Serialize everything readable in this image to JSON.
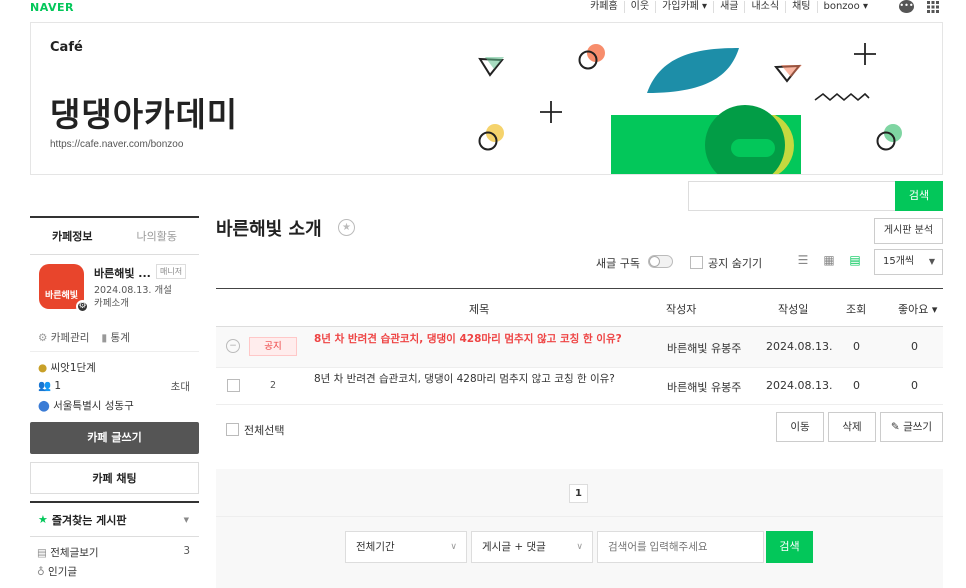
{
  "gnb": {
    "logo": "NAVER",
    "links": [
      "카페홈",
      "이웃",
      "가입카페 ▾",
      "새글",
      "내소식",
      "채팅",
      "bonzoo ▾"
    ]
  },
  "banner": {
    "logo": "Café",
    "cafe_name": "댕댕아카데미",
    "url": "https://cafe.naver.com/bonzoo"
  },
  "top_search": {
    "button": "검색"
  },
  "sidebar": {
    "tabs": [
      "카페정보",
      "나의활동"
    ],
    "profile": {
      "image_text": "바른해빛",
      "name": "바른해빛 ...",
      "badge": "매니저",
      "opened": "2024.08.13. 개설",
      "role": "카페소개"
    },
    "manage": [
      "카페관리",
      "통계"
    ],
    "info": {
      "level": "씨앗1단계",
      "members": "1",
      "invite": "초대",
      "location": "서울특별시 성동구"
    },
    "write_button": "카페 글쓰기",
    "chat_button": "카페 채팅",
    "favorites": "즐겨찾는 게시판",
    "boards": [
      {
        "label": "전체글보기",
        "count": "3"
      },
      {
        "label": "인기글",
        "count": ""
      }
    ]
  },
  "main": {
    "board_title": "바른해빛 소개",
    "analysis_button": "게시판 분석",
    "subscribe_label": "새글 구독",
    "hide_notice_label": "공지 숨기기",
    "per_page": "15개씩",
    "columns": {
      "title": "제목",
      "author": "작성자",
      "date": "작성일",
      "views": "조회",
      "likes": "좋아요 ▾"
    },
    "notice": {
      "badge": "공지",
      "title": "8년 차 반려견 습관코치, 댕댕이 428마리 멈추지 않고 코칭 한 이유?",
      "author": "바른해빛 유봉주",
      "date": "2024.08.13.",
      "views": "0",
      "likes": "0"
    },
    "posts": [
      {
        "num": "2",
        "title": "8년 차 반려견 습관코치, 댕댕이 428마리 멈추지 않고 코칭 한 이유?",
        "author": "바른해빛 유봉주",
        "date": "2024.08.13.",
        "views": "0",
        "likes": "0"
      }
    ],
    "select_all": "전체선택",
    "move_button": "이동",
    "delete_button": "삭제",
    "write_button": "글쓰기",
    "page": "1",
    "search": {
      "period": "전체기간",
      "scope": "게시글 + 댓글",
      "placeholder": "검색어를 입력해주세요",
      "button": "검색"
    }
  },
  "colors": {
    "accent": "#03c75a",
    "notice_red": "#e44444"
  }
}
